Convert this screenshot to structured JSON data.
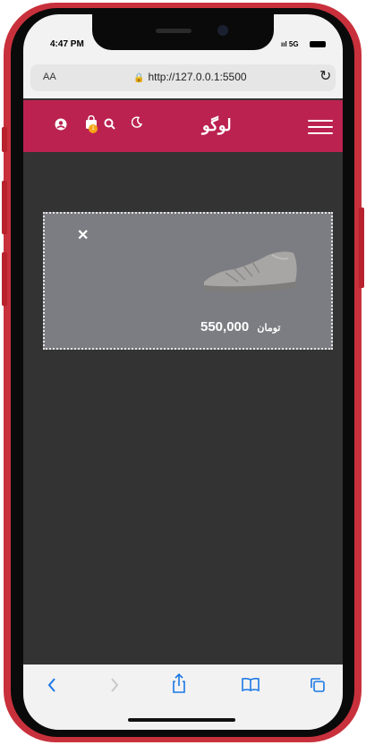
{
  "status_bar": {
    "time": "4:47 PM",
    "network": "5G"
  },
  "browser": {
    "aa_label": "AA",
    "url": "http://127.0.0.1:5500"
  },
  "navbar": {
    "logo": "لوگو",
    "cart_count": "1",
    "icons": [
      "user-icon",
      "shopping-bag-icon",
      "search-icon",
      "moon-icon",
      "menu-icon"
    ]
  },
  "cart_item": {
    "price": "550,000",
    "currency": "تومان",
    "image": "shoe-image"
  },
  "bottom_toolbar": {
    "icons": [
      "back-icon",
      "forward-icon",
      "share-icon",
      "bookmarks-icon",
      "tabs-icon"
    ]
  },
  "colors": {
    "navbar": "#bb2250",
    "page_bg": "#333333",
    "card_bg": "#7c7d82",
    "badge": "#f7a516",
    "phone_frame": "#c8313c",
    "toolbar_accent": "#1b78e6"
  }
}
